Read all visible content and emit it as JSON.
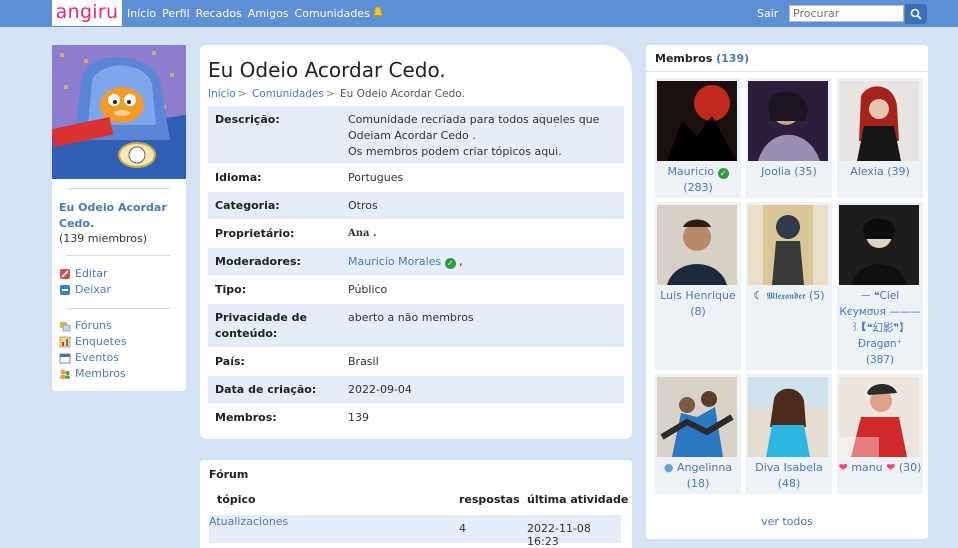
{
  "topbar": {
    "logo": "angiru",
    "nav": [
      "Início",
      "Perfil",
      "Recados",
      "Amigos",
      "Comunidades"
    ],
    "logout": "Sair",
    "search_placeholder": "Procurar"
  },
  "sidebar": {
    "community_name": "Eu Odeio Acordar Cedo.",
    "member_count": "(139 miembros)",
    "actions": [
      {
        "label": "Editar",
        "icon": "edit-icon"
      },
      {
        "label": "Deixar",
        "icon": "leave-icon"
      }
    ],
    "links": [
      {
        "label": "Fóruns",
        "icon": "forums-icon"
      },
      {
        "label": "Enquetes",
        "icon": "polls-icon"
      },
      {
        "label": "Eventos",
        "icon": "events-icon"
      },
      {
        "label": "Membros",
        "icon": "members-icon"
      }
    ]
  },
  "main": {
    "title": "Eu Odeio Acordar Cedo.",
    "breadcrumb": [
      "Início",
      "Comunidades",
      "Eu Odeio Acordar Cedo."
    ],
    "info": [
      {
        "label": "Descrição:",
        "value": "Comunidade recriada para todos aqueles que Odeiam Acordar Cedo .\nOs membros podem criar tópicos aqui."
      },
      {
        "label": "Idioma:",
        "value": "Portugues"
      },
      {
        "label": "Categoria:",
        "value": "Otros"
      },
      {
        "label": "Proprietário:",
        "value": "Ana ."
      },
      {
        "label": "Moderadores:",
        "value": "Mauricio Morales",
        "suffix": ","
      },
      {
        "label": "Tipo:",
        "value": "Público"
      },
      {
        "label": "Privacidade de conteúdo:",
        "value": "aberto a não membros"
      },
      {
        "label": "País:",
        "value": "Brasil"
      },
      {
        "label": "Data de criação:",
        "value": "2022-09-04"
      },
      {
        "label": "Membros:",
        "value": "139"
      }
    ]
  },
  "forum": {
    "title": "Fórum",
    "headers": {
      "topic": "tópico",
      "replies": "respostas",
      "last": "última atividade"
    },
    "rows": [
      {
        "topic": "Atualizaciones",
        "replies": "4",
        "last": "2022-11-08 16:23"
      }
    ]
  },
  "members": {
    "title": "Membros",
    "count": "(139)",
    "view_all": "ver todos",
    "list": [
      {
        "name": "Mauricio",
        "count": "(283)",
        "verified": true
      },
      {
        "name": "Joolia",
        "count": "(35)"
      },
      {
        "name": "Alexia",
        "count": "(39)"
      },
      {
        "name": "Luis Henrique",
        "count": "(8)"
      },
      {
        "name": "𝕸𝖑𝖊𝖝𝖆𝖓𝖉𝖊𝖗",
        "count": "(5)"
      },
      {
        "name": "ᅳ ❝Ciel Кєумσυя ———꒱【❝幻影❞】Ðragøn⁺",
        "count": "(387)"
      },
      {
        "name": "Angelinna",
        "count": "(18)"
      },
      {
        "name": "Diva Isabela",
        "count": "(48)"
      },
      {
        "name": "manu",
        "count": "(30)"
      }
    ]
  },
  "colors": {
    "topbar": "#5d8fd4",
    "background": "#d4e2f3",
    "link": "#4a7ab5",
    "logo": "#e7247a",
    "row_alt": "#e5eef8"
  }
}
